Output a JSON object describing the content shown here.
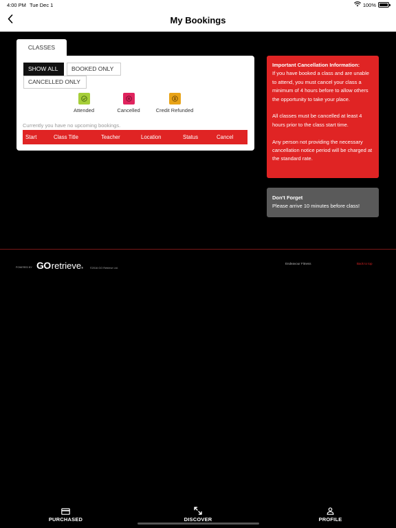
{
  "status_bar": {
    "time": "4:00 PM",
    "date": "Tue Dec 1",
    "battery": "100%",
    "battery_level": 1.0,
    "icons": [
      "wifi-icon",
      "battery-icon"
    ]
  },
  "header": {
    "title": "My Bookings",
    "back_icon": "chevron-left-icon"
  },
  "tab": {
    "label": "CLASSES"
  },
  "filters": {
    "show_all": "SHOW ALL",
    "booked_only": "BOOKED ONLY",
    "cancelled_only": "CANCELLED ONLY",
    "active": "SHOW ALL"
  },
  "legend": [
    {
      "label": "Attended",
      "icon": "attended-icon",
      "color": "#a6ce39"
    },
    {
      "label": "Cancelled",
      "icon": "cancelled-icon",
      "color": "#e0245e"
    },
    {
      "label": "Credit Refunded",
      "icon": "credit-refunded-icon",
      "color": "#e8a317"
    }
  ],
  "bookings": {
    "empty_message": "Currently you have no upcoming bookings.",
    "columns": [
      "Start",
      "Class Title",
      "Teacher",
      "Location",
      "Status",
      "Cancel"
    ],
    "rows": []
  },
  "cancellation_info": {
    "title": "Important Cancellation Information:",
    "paragraphs": [
      "If you have booked a class and are unable to attend, you must cancel your class a minimum of 4 hours before to allow others the opportunity to take your place.",
      "All classes must be cancelled at least 4 hours prior to the class start time.",
      "Any person not providing the necessary cancellation notice period will be charged at the standard rate."
    ]
  },
  "reminder": {
    "title": "Don't Forget",
    "text": "Please arrive 10 minutes before class!"
  },
  "footer": {
    "powered_by": "POWERED BY",
    "logo_go": "GO",
    "logo_retrieve": "retrieve",
    "logo_reg": "®",
    "copyright": "©2016 GO Retrieve Ltd.",
    "venue": "Endeavour Fitness",
    "link": "Back to top"
  },
  "tabbar": [
    {
      "label": "PURCHASED",
      "icon": "card-icon"
    },
    {
      "label": "DISCOVER",
      "icon": "expand-icon"
    },
    {
      "label": "PROFILE",
      "icon": "person-icon"
    }
  ],
  "colors": {
    "accent_red": "#e02424",
    "panel_grey": "#5a5a5a",
    "background": "#000000"
  }
}
